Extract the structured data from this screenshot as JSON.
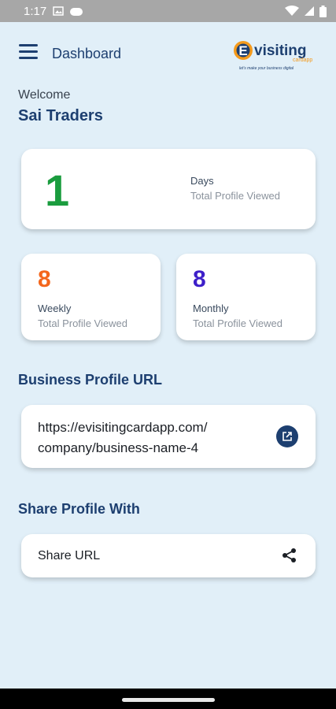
{
  "status_bar": {
    "time": "1:17",
    "icons": [
      "photo-icon",
      "cloud-icon",
      "wifi-icon",
      "signal-icon",
      "battery-icon"
    ]
  },
  "header": {
    "title": "Dashboard",
    "logo": {
      "brand_letter": "E",
      "brand_word": "visiting",
      "brand_sub": "cardapp",
      "tagline": "let's make your business digital"
    }
  },
  "greeting": {
    "welcome": "Welcome",
    "company_name": "Sai Traders"
  },
  "stats": {
    "days": {
      "value": "1",
      "period": "Days",
      "description": "Total Profile Viewed"
    },
    "weekly": {
      "value": "8",
      "period": "Weekly",
      "description": "Total Profile Viewed"
    },
    "monthly": {
      "value": "8",
      "period": "Monthly",
      "description": "Total Profile Viewed"
    }
  },
  "business_url": {
    "heading": "Business Profile URL",
    "line1": "https://evisitingcardapp.com/",
    "line2": "company/business-name-4"
  },
  "share": {
    "heading": "Share Profile With",
    "label": "Share URL"
  },
  "colors": {
    "background": "#e1eff8",
    "primary": "#1d3f70",
    "days_value": "#1a9c3e",
    "weekly_value": "#f4661c",
    "monthly_value": "#3d1fc9"
  }
}
